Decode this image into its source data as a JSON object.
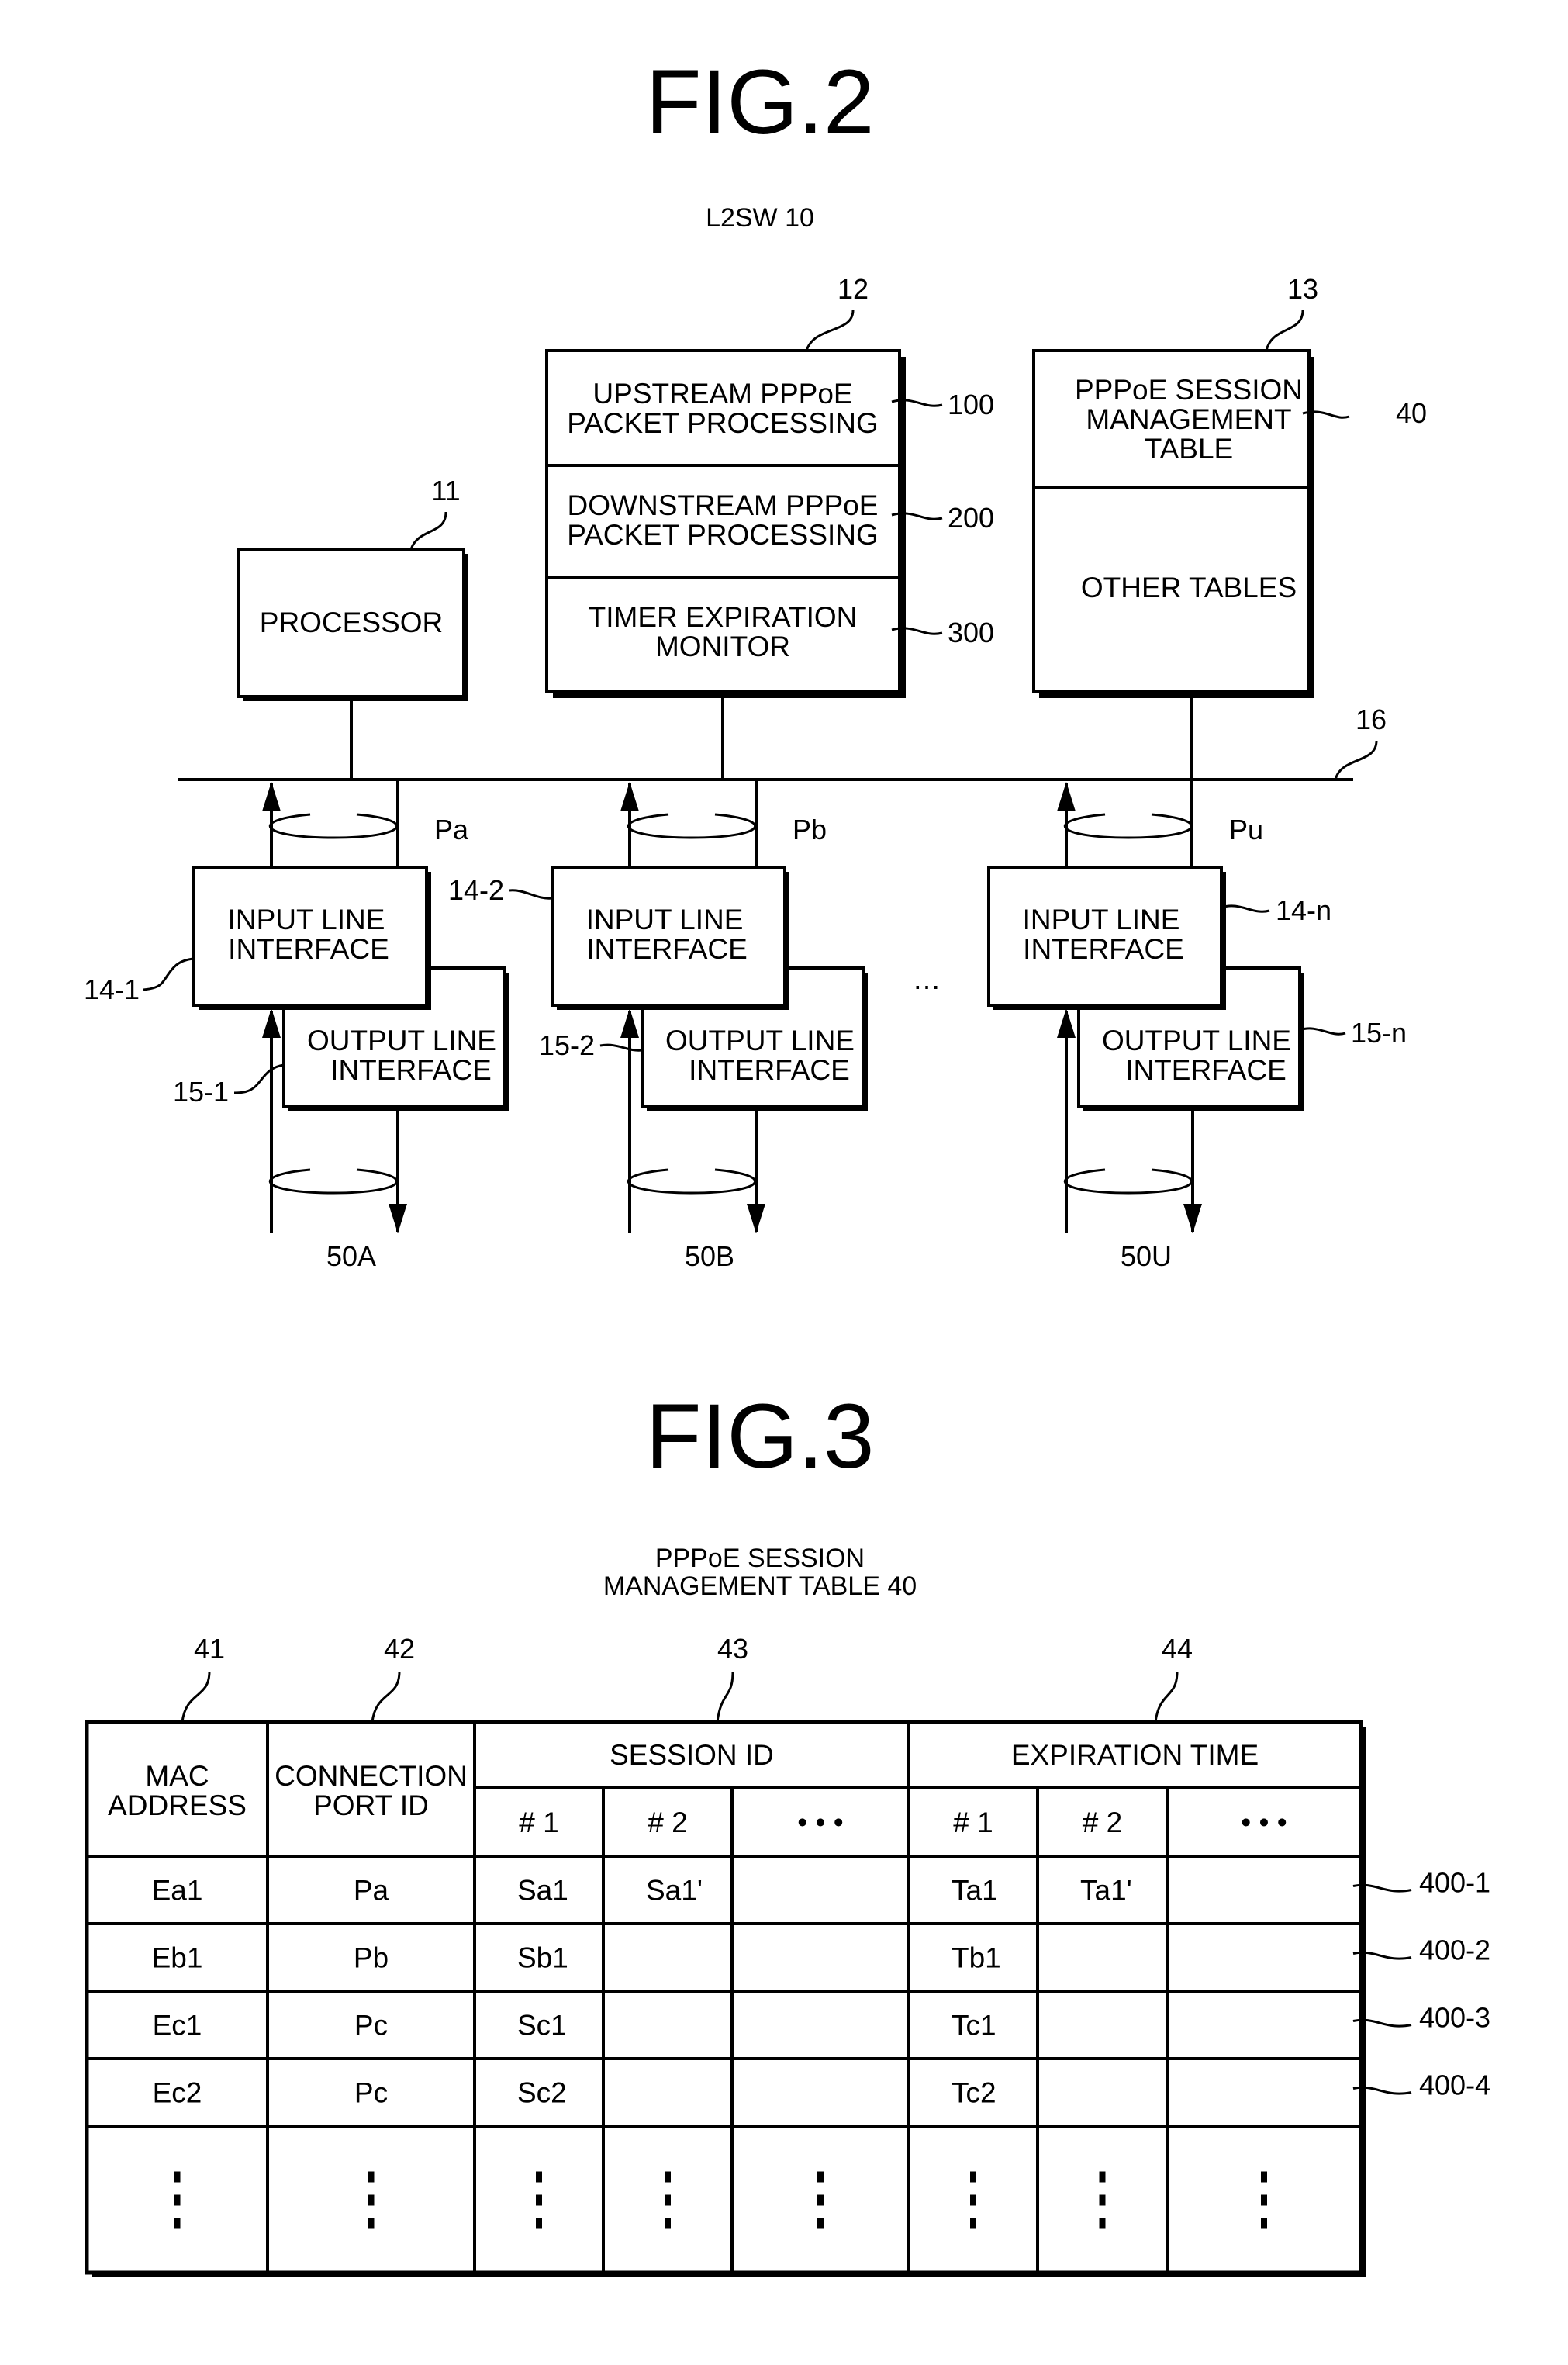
{
  "fig2": {
    "title": "FIG.2",
    "caption": "L2SW  10",
    "processor": {
      "ref": "11",
      "label": "PROCESSOR"
    },
    "packet_unit": {
      "ref": "12",
      "sections": [
        {
          "ref": "100",
          "lines": [
            "UPSTREAM PPPoE",
            "PACKET PROCESSING"
          ]
        },
        {
          "ref": "200",
          "lines": [
            "DOWNSTREAM PPPoE",
            "PACKET PROCESSING"
          ]
        },
        {
          "ref": "300",
          "lines": [
            "TIMER EXPIRATION",
            "MONITOR"
          ]
        }
      ]
    },
    "table_memory": {
      "ref": "13",
      "session_table": {
        "ref": "40",
        "lines": [
          "PPPoE SESSION",
          "MANAGEMENT",
          "TABLE"
        ]
      },
      "other": "OTHER TABLES"
    },
    "bus_ref": "16",
    "ellipsis": "…",
    "ports": [
      {
        "input_ref": "14-1",
        "output_ref": "15-1",
        "port": "Pa",
        "line": "50A",
        "input_lines": [
          "INPUT LINE",
          "INTERFACE"
        ],
        "output_lines": [
          "OUTPUT LINE",
          "INTERFACE"
        ]
      },
      {
        "input_ref": "14-2",
        "output_ref": "15-2",
        "port": "Pb",
        "line": "50B",
        "input_lines": [
          "INPUT LINE",
          "INTERFACE"
        ],
        "output_lines": [
          "OUTPUT LINE",
          "INTERFACE"
        ]
      },
      {
        "input_ref": "14-n",
        "output_ref": "15-n",
        "port": "Pu",
        "line": "50U",
        "input_lines": [
          "INPUT LINE",
          "INTERFACE"
        ],
        "output_lines": [
          "OUTPUT LINE",
          "INTERFACE"
        ]
      }
    ]
  },
  "fig3": {
    "title": "FIG.3",
    "caption_lines": [
      "PPPoE SESSION",
      "MANAGEMENT TABLE  40"
    ],
    "column_refs": [
      "41",
      "42",
      "43",
      "44"
    ],
    "headers": {
      "mac": [
        "MAC",
        "ADDRESS"
      ],
      "port": [
        "CONNECTION",
        "PORT ID"
      ],
      "session": "SESSION ID",
      "expiration": "EXPIRATION TIME",
      "sub": [
        "# 1",
        "# 2",
        "• • •"
      ]
    },
    "rows": [
      {
        "ref": "400-1",
        "mac": "Ea1",
        "port": "Pa",
        "session": [
          "Sa1",
          "Sa1'",
          ""
        ],
        "expiration": [
          "Ta1",
          "Ta1'",
          ""
        ]
      },
      {
        "ref": "400-2",
        "mac": "Eb1",
        "port": "Pb",
        "session": [
          "Sb1",
          "",
          ""
        ],
        "expiration": [
          "Tb1",
          "",
          ""
        ]
      },
      {
        "ref": "400-3",
        "mac": "Ec1",
        "port": "Pc",
        "session": [
          "Sc1",
          "",
          ""
        ],
        "expiration": [
          "Tc1",
          "",
          ""
        ]
      },
      {
        "ref": "400-4",
        "mac": "Ec2",
        "port": "Pc",
        "session": [
          "Sc2",
          "",
          ""
        ],
        "expiration": [
          "Tc2",
          "",
          ""
        ]
      }
    ],
    "continuation": "⋮"
  }
}
